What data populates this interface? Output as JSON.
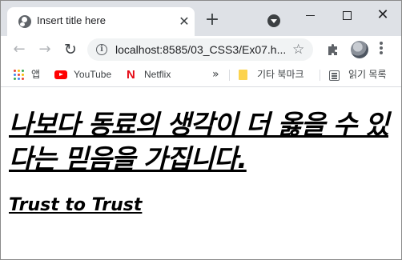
{
  "browser": {
    "tab": {
      "title": "Insert title here",
      "close_glyph": "✕"
    },
    "new_tab_glyph": "+",
    "window_close_glyph": "✕",
    "toolbar": {
      "back_glyph": "←",
      "forward_glyph": "→",
      "reload_glyph": "↻",
      "info_glyph": "i",
      "url": "localhost:8585/03_CSS3/Ex07.h...",
      "star_glyph": "☆"
    },
    "bookmarks": {
      "apps_label": "앱",
      "youtube_label": "YouTube",
      "netflix_label": "Netflix",
      "netflix_letter": "N",
      "overflow_glyph": "»",
      "other_bookmarks_label": "기타 북마크",
      "reading_list_label": "읽기 목록"
    },
    "icons": {
      "apps_colors": [
        "#ea4335",
        "#fbbc04",
        "#34a853",
        "#4285f4"
      ],
      "youtube_color": "#ff0000",
      "netflix_color": "#e50914",
      "folder_color": "#fcd34d"
    }
  },
  "page": {
    "heading": "나보다 동료의 생각이 더 옳을 수 있다는 믿음을 가집니다.",
    "subheading": "Trust to Trust"
  }
}
